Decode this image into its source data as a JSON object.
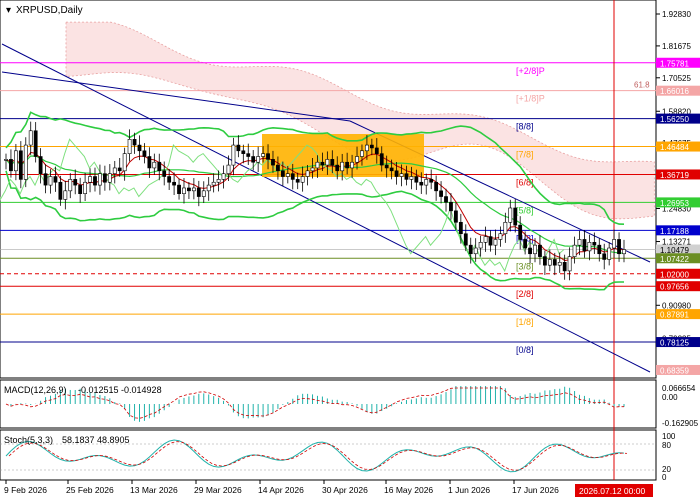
{
  "chart_data": [
    {
      "type": "candlestick",
      "title": "XRPUSD,Daily",
      "ylim": [
        0.6835,
        1.98
      ],
      "price_axis_ticks": [
        "1.92830",
        "1.81675",
        "1.70525",
        "1.58820",
        "1.47675",
        "1.36521",
        "1.24830",
        "1.13271",
        "1.02025",
        "0.90980",
        "0.79335"
      ],
      "price_labels": [
        {
          "value": 1.75781,
          "text": "1.75781",
          "bg": "#ff00ff",
          "fg": "#ffffff"
        },
        {
          "value": 1.66016,
          "text": "1.66016",
          "bg": "#f4a6a6",
          "fg": "#ffffff"
        },
        {
          "value": 1.5625,
          "text": "1.56250",
          "bg": "#00008b",
          "fg": "#ffffff"
        },
        {
          "value": 1.46484,
          "text": "1.46484",
          "bg": "#ffa500",
          "fg": "#ffffff"
        },
        {
          "value": 1.36719,
          "text": "1.36719",
          "bg": "#e00000",
          "fg": "#ffffff"
        },
        {
          "value": 1.26953,
          "text": "1.26953",
          "bg": "#32cd32",
          "fg": "#ffffff"
        },
        {
          "value": 1.17188,
          "text": "1.17188",
          "bg": "#0000cd",
          "fg": "#ffffff"
        },
        {
          "value": 1.10479,
          "text": "1.10479",
          "bg": "#d0d0d0",
          "fg": "#000000"
        },
        {
          "value": 1.07422,
          "text": "1.07422",
          "bg": "#6b8e23",
          "fg": "#ffffff"
        },
        {
          "value": 1.02,
          "text": "1.02000",
          "bg": "#e00000",
          "fg": "#ffffff"
        },
        {
          "value": 0.97656,
          "text": "0.97656",
          "bg": "#e00000",
          "fg": "#ffffff"
        },
        {
          "value": 0.87891,
          "text": "0.87891",
          "bg": "#ffa500",
          "fg": "#ffffff"
        },
        {
          "value": 0.78125,
          "text": "0.78125",
          "bg": "#00008b",
          "fg": "#ffffff"
        },
        {
          "value": 0.68359,
          "text": "0.68359",
          "bg": "#f4a6a6",
          "fg": "#ffffff"
        }
      ],
      "murrey_levels": [
        {
          "label": "[+2/8]P",
          "value": 1.75781,
          "color": "#ff00ff"
        },
        {
          "label": "[+1/8]P",
          "value": 1.66016,
          "color": "#f4a6a6"
        },
        {
          "label": "[8/8]",
          "value": 1.5625,
          "color": "#00008b"
        },
        {
          "label": "[7/8]",
          "value": 1.46484,
          "color": "#ffa500"
        },
        {
          "label": "[6/8]",
          "value": 1.36719,
          "color": "#e00000"
        },
        {
          "label": "[5/8]",
          "value": 1.26953,
          "color": "#32cd32"
        },
        {
          "label": "[4/8]",
          "value": 1.17188,
          "color": "#0000cd"
        },
        {
          "label": "[3/8]",
          "value": 1.07422,
          "color": "#6b8e23"
        },
        {
          "label": "[2/8]",
          "value": 0.97656,
          "color": "#e00000"
        },
        {
          "label": "[1/8]",
          "value": 0.87891,
          "color": "#ffa500"
        },
        {
          "label": "[0/8]",
          "value": 0.78125,
          "color": "#00008b"
        }
      ],
      "fib_label": "61.8",
      "support_dashed": 1.02,
      "current_price": 1.10479,
      "x_dates": [
        "9 Feb 2026",
        "25 Feb 2026",
        "13 Mar 2026",
        "29 Mar 2026",
        "14 Apr 2026",
        "30 Apr 2026",
        "16 May 2026",
        "1 Jun 2026",
        "17 Jun 2026"
      ],
      "cursor_date": "2026.07.12 00:00",
      "closes": [
        1.42,
        1.38,
        1.45,
        1.35,
        1.47,
        1.52,
        1.43,
        1.37,
        1.33,
        1.36,
        1.34,
        1.28,
        1.31,
        1.35,
        1.33,
        1.3,
        1.34,
        1.36,
        1.33,
        1.37,
        1.34,
        1.37,
        1.39,
        1.38,
        1.44,
        1.49,
        1.47,
        1.45,
        1.43,
        1.39,
        1.41,
        1.38,
        1.36,
        1.34,
        1.33,
        1.3,
        1.32,
        1.31,
        1.32,
        1.29,
        1.31,
        1.33,
        1.34,
        1.35,
        1.37,
        1.4,
        1.47,
        1.45,
        1.44,
        1.43,
        1.41,
        1.43,
        1.44,
        1.42,
        1.4,
        1.38,
        1.36,
        1.37,
        1.35,
        1.34,
        1.36,
        1.38,
        1.39,
        1.41,
        1.4,
        1.42,
        1.4,
        1.38,
        1.41,
        1.39,
        1.41,
        1.43,
        1.45,
        1.47,
        1.46,
        1.44,
        1.4,
        1.39,
        1.38,
        1.36,
        1.37,
        1.35,
        1.36,
        1.34,
        1.33,
        1.35,
        1.34,
        1.31,
        1.29,
        1.27,
        1.24,
        1.2,
        1.16,
        1.12,
        1.09,
        1.11,
        1.13,
        1.15,
        1.12,
        1.14,
        1.16,
        1.2,
        1.25,
        1.19,
        1.14,
        1.11,
        1.09,
        1.12,
        1.08,
        1.05,
        1.07,
        1.05,
        1.06,
        1.03,
        1.08,
        1.12,
        1.14,
        1.1,
        1.13,
        1.12,
        1.09,
        1.07,
        1.11,
        1.14,
        1.09,
        1.1048
      ],
      "macd": {
        "label": "MACD(12,26,9)",
        "values": "-0.012515 -0.014928",
        "ticks": [
          "0.066654",
          "0.00",
          "-0.162905"
        ]
      },
      "stoch": {
        "label": "Stoch(5,3,3)",
        "values": "58.1837 48.8905",
        "ticks": [
          "100",
          "80",
          "20",
          "0"
        ]
      }
    }
  ]
}
